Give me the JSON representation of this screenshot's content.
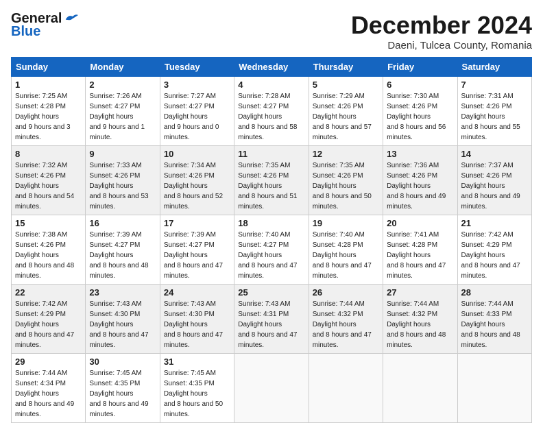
{
  "header": {
    "logo_line1": "General",
    "logo_line2": "Blue",
    "month_title": "December 2024",
    "subtitle": "Daeni, Tulcea County, Romania"
  },
  "weekdays": [
    "Sunday",
    "Monday",
    "Tuesday",
    "Wednesday",
    "Thursday",
    "Friday",
    "Saturday"
  ],
  "weeks": [
    [
      {
        "day": "1",
        "sunrise": "7:25 AM",
        "sunset": "4:28 PM",
        "daylight": "9 hours and 3 minutes."
      },
      {
        "day": "2",
        "sunrise": "7:26 AM",
        "sunset": "4:27 PM",
        "daylight": "9 hours and 1 minute."
      },
      {
        "day": "3",
        "sunrise": "7:27 AM",
        "sunset": "4:27 PM",
        "daylight": "9 hours and 0 minutes."
      },
      {
        "day": "4",
        "sunrise": "7:28 AM",
        "sunset": "4:27 PM",
        "daylight": "8 hours and 58 minutes."
      },
      {
        "day": "5",
        "sunrise": "7:29 AM",
        "sunset": "4:26 PM",
        "daylight": "8 hours and 57 minutes."
      },
      {
        "day": "6",
        "sunrise": "7:30 AM",
        "sunset": "4:26 PM",
        "daylight": "8 hours and 56 minutes."
      },
      {
        "day": "7",
        "sunrise": "7:31 AM",
        "sunset": "4:26 PM",
        "daylight": "8 hours and 55 minutes."
      }
    ],
    [
      {
        "day": "8",
        "sunrise": "7:32 AM",
        "sunset": "4:26 PM",
        "daylight": "8 hours and 54 minutes."
      },
      {
        "day": "9",
        "sunrise": "7:33 AM",
        "sunset": "4:26 PM",
        "daylight": "8 hours and 53 minutes."
      },
      {
        "day": "10",
        "sunrise": "7:34 AM",
        "sunset": "4:26 PM",
        "daylight": "8 hours and 52 minutes."
      },
      {
        "day": "11",
        "sunrise": "7:35 AM",
        "sunset": "4:26 PM",
        "daylight": "8 hours and 51 minutes."
      },
      {
        "day": "12",
        "sunrise": "7:35 AM",
        "sunset": "4:26 PM",
        "daylight": "8 hours and 50 minutes."
      },
      {
        "day": "13",
        "sunrise": "7:36 AM",
        "sunset": "4:26 PM",
        "daylight": "8 hours and 49 minutes."
      },
      {
        "day": "14",
        "sunrise": "7:37 AM",
        "sunset": "4:26 PM",
        "daylight": "8 hours and 49 minutes."
      }
    ],
    [
      {
        "day": "15",
        "sunrise": "7:38 AM",
        "sunset": "4:26 PM",
        "daylight": "8 hours and 48 minutes."
      },
      {
        "day": "16",
        "sunrise": "7:39 AM",
        "sunset": "4:27 PM",
        "daylight": "8 hours and 48 minutes."
      },
      {
        "day": "17",
        "sunrise": "7:39 AM",
        "sunset": "4:27 PM",
        "daylight": "8 hours and 47 minutes."
      },
      {
        "day": "18",
        "sunrise": "7:40 AM",
        "sunset": "4:27 PM",
        "daylight": "8 hours and 47 minutes."
      },
      {
        "day": "19",
        "sunrise": "7:40 AM",
        "sunset": "4:28 PM",
        "daylight": "8 hours and 47 minutes."
      },
      {
        "day": "20",
        "sunrise": "7:41 AM",
        "sunset": "4:28 PM",
        "daylight": "8 hours and 47 minutes."
      },
      {
        "day": "21",
        "sunrise": "7:42 AM",
        "sunset": "4:29 PM",
        "daylight": "8 hours and 47 minutes."
      }
    ],
    [
      {
        "day": "22",
        "sunrise": "7:42 AM",
        "sunset": "4:29 PM",
        "daylight": "8 hours and 47 minutes."
      },
      {
        "day": "23",
        "sunrise": "7:43 AM",
        "sunset": "4:30 PM",
        "daylight": "8 hours and 47 minutes."
      },
      {
        "day": "24",
        "sunrise": "7:43 AM",
        "sunset": "4:30 PM",
        "daylight": "8 hours and 47 minutes."
      },
      {
        "day": "25",
        "sunrise": "7:43 AM",
        "sunset": "4:31 PM",
        "daylight": "8 hours and 47 minutes."
      },
      {
        "day": "26",
        "sunrise": "7:44 AM",
        "sunset": "4:32 PM",
        "daylight": "8 hours and 47 minutes."
      },
      {
        "day": "27",
        "sunrise": "7:44 AM",
        "sunset": "4:32 PM",
        "daylight": "8 hours and 48 minutes."
      },
      {
        "day": "28",
        "sunrise": "7:44 AM",
        "sunset": "4:33 PM",
        "daylight": "8 hours and 48 minutes."
      }
    ],
    [
      {
        "day": "29",
        "sunrise": "7:44 AM",
        "sunset": "4:34 PM",
        "daylight": "8 hours and 49 minutes."
      },
      {
        "day": "30",
        "sunrise": "7:45 AM",
        "sunset": "4:35 PM",
        "daylight": "8 hours and 49 minutes."
      },
      {
        "day": "31",
        "sunrise": "7:45 AM",
        "sunset": "4:35 PM",
        "daylight": "8 hours and 50 minutes."
      },
      null,
      null,
      null,
      null
    ]
  ]
}
